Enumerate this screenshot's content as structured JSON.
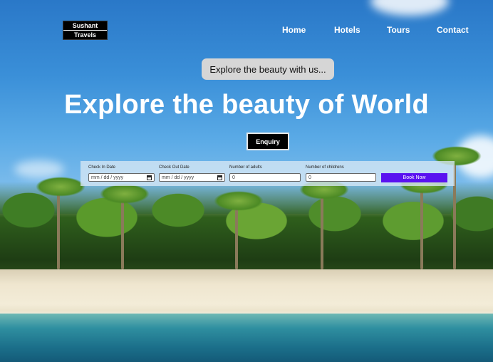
{
  "brand": {
    "line1": "Sushant",
    "line2": "Travels"
  },
  "nav": {
    "home": "Home",
    "hotels": "Hotels",
    "tours": "Tours",
    "contact": "Contact"
  },
  "hero": {
    "tagline": "Explore the beauty with us...",
    "headline": "Explore the beauty of World",
    "enquiry_label": "Enquiry"
  },
  "booking": {
    "checkin_label": "Check In Date",
    "checkin_placeholder": "mm / dd / yyyy",
    "checkout_label": "Check Out Date",
    "checkout_placeholder": "mm / dd / yyyy",
    "adults_label": "Number of adults",
    "adults_value": "0",
    "children_label": "Number of childrens",
    "children_value": "0",
    "book_label": "Book Now"
  },
  "colors": {
    "accent": "#5a12f0",
    "logo_bg": "#000000",
    "pill_bg": "#d6d6d6"
  },
  "icons": [
    "calendar-icon"
  ]
}
